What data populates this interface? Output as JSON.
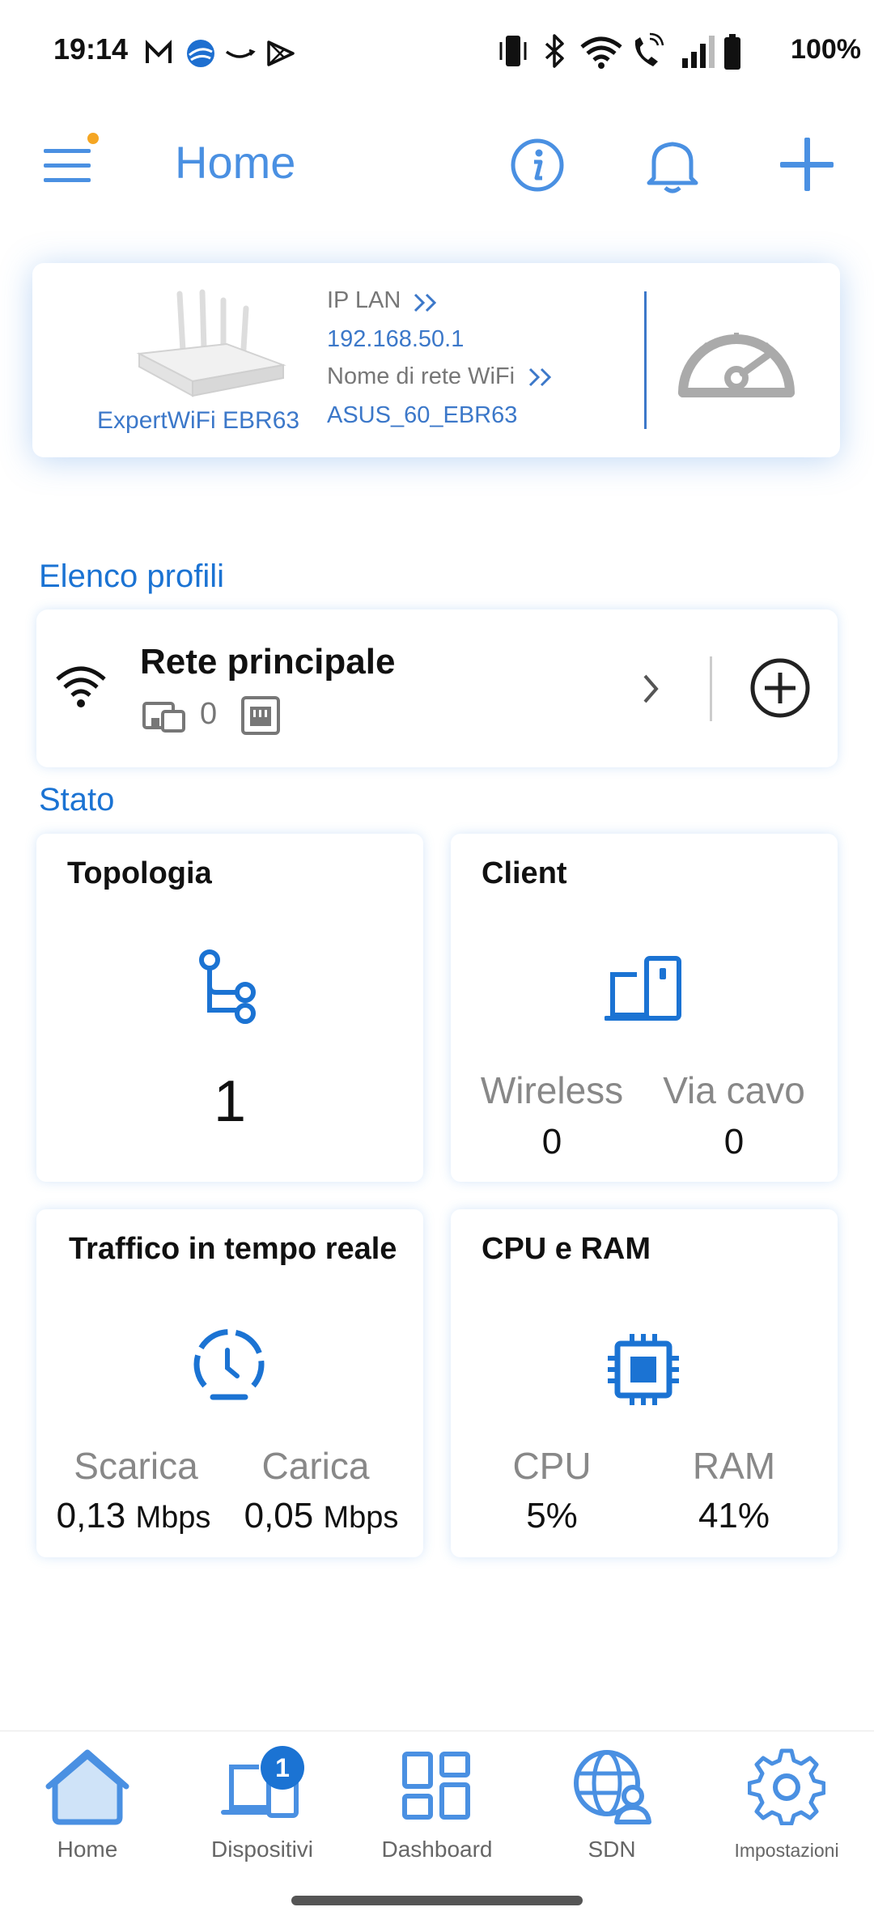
{
  "status_bar": {
    "time": "19:14",
    "battery": "100%"
  },
  "header": {
    "title": "Home",
    "accent_color": "#4A90E2"
  },
  "router": {
    "model": "ExpertWiFi EBR63",
    "ip_label": "IP LAN",
    "ip_value": "192.168.50.1",
    "wifi_label": "Nome di rete WiFi",
    "wifi_value": "ASUS_60_EBR63"
  },
  "profiles": {
    "section_title": "Elenco profili",
    "items": [
      {
        "name": "Rete principale",
        "device_count": "0"
      }
    ]
  },
  "status": {
    "section_title": "Stato",
    "topology": {
      "title": "Topologia",
      "value": "1"
    },
    "clients": {
      "title": "Client",
      "wireless_label": "Wireless",
      "wireless_value": "0",
      "wired_label": "Via cavo",
      "wired_value": "0"
    },
    "traffic": {
      "title": "Traffico in tempo reale",
      "download_label": "Scarica",
      "download_value": "0,13",
      "download_unit": "Mbps",
      "upload_label": "Carica",
      "upload_value": "0,05",
      "upload_unit": "Mbps"
    },
    "cpu_ram": {
      "title": "CPU e RAM",
      "cpu_label": "CPU",
      "cpu_value": "5%",
      "ram_label": "RAM",
      "ram_value": "41%"
    }
  },
  "nav": {
    "items": [
      {
        "label": "Home",
        "icon": "home-icon"
      },
      {
        "label": "Dispositivi",
        "icon": "devices-icon",
        "badge": "1"
      },
      {
        "label": "Dashboard",
        "icon": "dashboard-icon"
      },
      {
        "label": "SDN",
        "icon": "sdn-icon"
      },
      {
        "label": "Impostazioni",
        "icon": "settings-icon"
      }
    ]
  }
}
